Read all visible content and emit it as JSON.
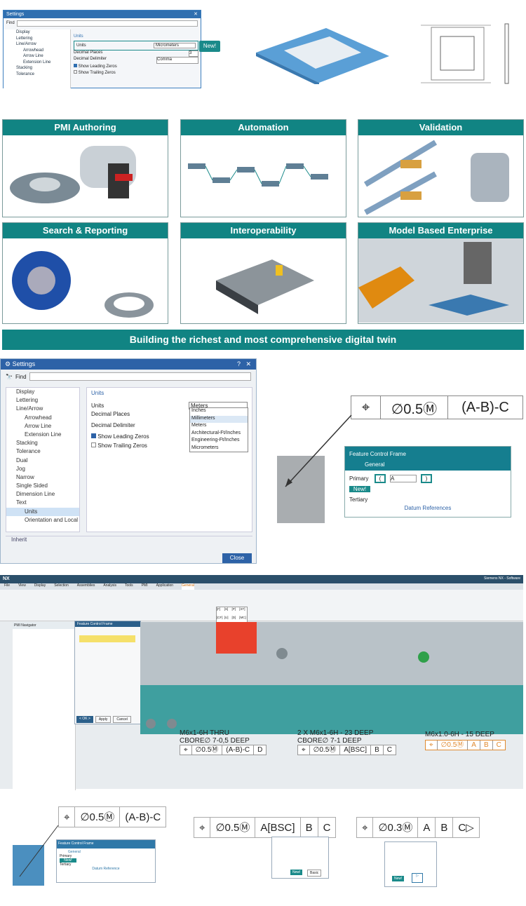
{
  "dlg1": {
    "title": "Settings",
    "close": "✕",
    "find": "Find",
    "tree": [
      "Display",
      "Lettering",
      "Line/Arrow",
      "Arrowhead",
      "Arrow Line",
      "Extension Line",
      "Stacking",
      "Tolerance"
    ],
    "section": "Units",
    "units_label": "Units",
    "units_value": "Micrometers",
    "decimal_places": "Decimal Places",
    "decimal_places_value": "3",
    "decimal_delim": "Decimal Delimiter",
    "delim_value": "Comma",
    "leading": "Show Leading Zeros",
    "trailing": "Show Trailing Zeros"
  },
  "new_tag": "New!",
  "panels": [
    "PMI Authoring",
    "Automation",
    "Validation",
    "Search & Reporting",
    "Interoperability",
    "Model Based Enterprise"
  ],
  "banner": "Building the richest and most comprehensive digital twin",
  "dlg2": {
    "title": "Settings",
    "help": "?",
    "close": "✕",
    "find": "Find",
    "tree": [
      "Display",
      "Lettering",
      "Line/Arrow",
      "Arrowhead",
      "Arrow Line",
      "Extension Line",
      "Stacking",
      "Tolerance",
      "Dual",
      "Jog",
      "Narrow",
      "Single Sided",
      "Dimension Line",
      "Text",
      "Units",
      "Orientation and Local"
    ],
    "section": "Units",
    "units": "Units",
    "units_value": "Meters",
    "decimal_places": "Decimal Places",
    "decimal_delim": "Decimal Delimiter",
    "leading": "Show Leading Zeros",
    "trailing": "Show Trailing Zeros",
    "options": [
      "Inches",
      "Millimeters",
      "Meters",
      "Architectural-Ft/Inches",
      "Engineering-Ft/Inches",
      "Micrometers"
    ],
    "inherit": "Inherit",
    "close_btn": "Close"
  },
  "fcf_big": {
    "symbol": "⌖",
    "tol": "∅0.5Ⓜ",
    "datums": "(A-B)-C"
  },
  "fcf_panel": {
    "title": "Feature Control Frame",
    "tab": "General",
    "rows": [
      "Primary",
      "New!",
      "Tertiary"
    ],
    "primary_value": "A",
    "paren_open": "(",
    "paren_close": ")",
    "footer": "Datum References"
  },
  "nx": {
    "logo": "NX",
    "app_title": "Siemens NX - Software",
    "menus": [
      "File",
      "View",
      "Display",
      "Selection",
      "Assemblies",
      "Analysis",
      "Tools",
      "PMI",
      "Application",
      "General"
    ],
    "navigator": "PMI Navigator",
    "dialog_title": "Feature Control Frame",
    "ok": "< OK >",
    "apply": "Apply",
    "cancel": "Cancel",
    "callouts": [
      {
        "line1": "M6x1-6H THRU",
        "line2": "CBORE∅ 7-0,5 DEEP",
        "fcf": [
          "⌖",
          "∅0.5Ⓜ",
          "(A-B)-C",
          "D"
        ]
      },
      {
        "line1": "2 X M6x1-6H - 23 DEEP",
        "line2": "CBORE∅ 7-1 DEEP",
        "fcf": [
          "⌖",
          "∅0.5Ⓜ",
          "A[BSC]",
          "B",
          "C"
        ]
      },
      {
        "line1": "M6x1.0-6H - 15 DEEP",
        "line2": "",
        "fcf": [
          "⌖",
          "∅0.5Ⓜ",
          "A",
          "B",
          "C"
        ]
      }
    ],
    "popup": [
      "[F]",
      "[S]",
      "[P]",
      "[ST]",
      "[CF]",
      "[U]",
      "[D]",
      "[MC]",
      "[SC]"
    ]
  },
  "bottom": [
    {
      "symbol": "⌖",
      "tol": "∅0.5Ⓜ",
      "datums": [
        "(A-B)-C"
      ]
    },
    {
      "symbol": "⌖",
      "tol": "∅0.5Ⓜ",
      "datums": [
        "A[BSC]",
        "B",
        "C"
      ]
    },
    {
      "symbol": "⌖",
      "tol": "∅0.3Ⓜ",
      "datums": [
        "A",
        "B",
        "C▷"
      ]
    }
  ],
  "mini": {
    "title": "Feature Control Frame",
    "tab": "General",
    "rows": [
      "Primary",
      "New!",
      "Tertiary"
    ],
    "footer": "Datum Reference",
    "new": "New!",
    "basic": "Basic"
  }
}
